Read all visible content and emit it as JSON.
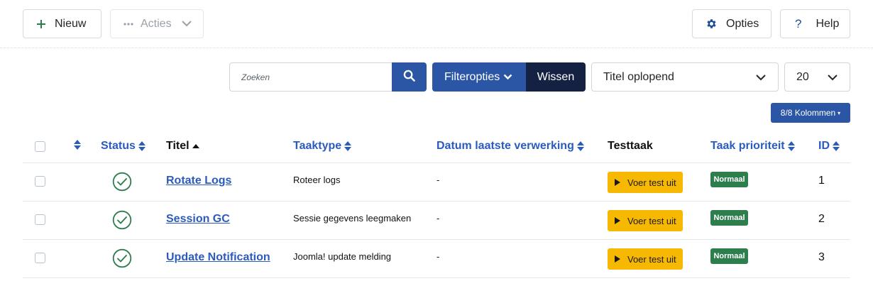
{
  "toolbar": {
    "new_label": "Nieuw",
    "actions_label": "Acties",
    "options_label": "Opties",
    "help_label": "Help"
  },
  "filters": {
    "search_placeholder": "Zoeken",
    "filter_options_label": "Filteropties",
    "clear_label": "Wissen",
    "order_value": "Titel oplopend",
    "limit_value": "20",
    "columns_label": "8/8 Kolommen"
  },
  "table": {
    "headers": {
      "status": "Status",
      "title": "Titel",
      "tasktype": "Taaktype",
      "last_run": "Datum laatste verwerking",
      "test": "Testtaak",
      "priority": "Taak prioriteit",
      "id": "ID"
    },
    "rows": [
      {
        "title": "Rotate Logs",
        "type": "Roteer logs",
        "last_run": "-",
        "test_label": "Voer test uit",
        "priority": "Normaal",
        "id": "1"
      },
      {
        "title": "Session GC",
        "type": "Sessie gegevens leegmaken",
        "last_run": "-",
        "test_label": "Voer test uit",
        "priority": "Normaal",
        "id": "2"
      },
      {
        "title": "Update Notification",
        "type": "Joomla! update melding",
        "last_run": "-",
        "test_label": "Voer test uit",
        "priority": "Normaal",
        "id": "3"
      }
    ]
  },
  "colors": {
    "primary": "#2b56a5",
    "dark": "#152142",
    "link": "#2b5bbf",
    "warning": "#f6b800",
    "success": "#2d7d4d"
  }
}
